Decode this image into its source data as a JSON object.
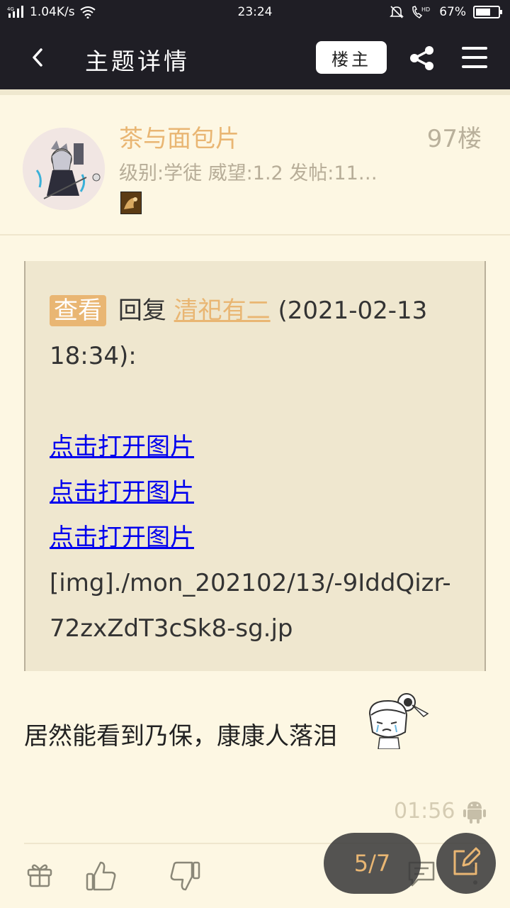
{
  "status_bar": {
    "network": "4G",
    "speed": "1.04K/s",
    "time": "23:24",
    "battery": "67%",
    "battery_level": 0.67
  },
  "header": {
    "title": "主题详情",
    "op_button": "楼主"
  },
  "post": {
    "username": "茶与面包片",
    "floor": "97楼",
    "meta": "级别:学徒 威望:1.2 发帖:11…",
    "quote": {
      "tag": "查看",
      "reply_word": "回复",
      "reply_user": "清祀有二",
      "reply_time": "(2021-02-13 18:34):",
      "image_links": [
        "点击打开图片",
        "点击打开图片",
        "点击打开图片"
      ],
      "raw_text": "[img]./mon_202102/13/-9IddQizr-72zxZdT3cSk8-sg.jp"
    },
    "body": "居然能看到乃保，康康人落泪",
    "time": "01:56"
  },
  "pager": {
    "label": "5/7"
  },
  "colors": {
    "accent": "#e9b673",
    "background": "#fdf7e3",
    "header": "#1f1e25",
    "quote_bg": "#efe7cf"
  }
}
